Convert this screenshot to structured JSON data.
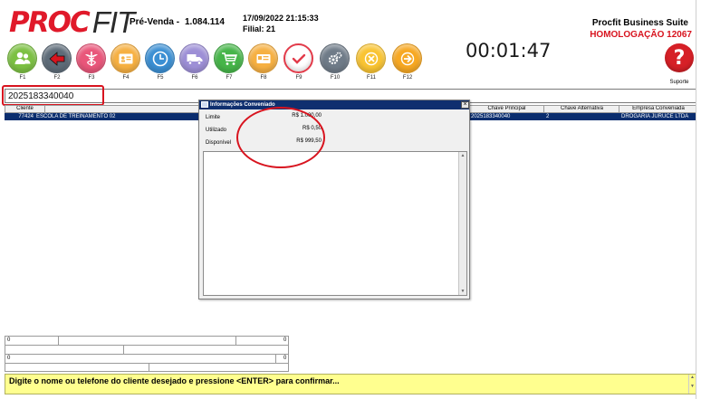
{
  "header": {
    "logo_proc": "PROC",
    "logo_fit": "FIT",
    "mode": "Pré-Venda -",
    "version": "1.084.114",
    "datetime": "17/09/2022 21:15:33",
    "filial": "Filial: 21",
    "suite": "Procfit Business Suite",
    "environment": "HOMOLOGAÇÃO 12067",
    "timer": "00:01:47"
  },
  "toolbar": {
    "keys": [
      {
        "label": "F1",
        "icon": "users-icon",
        "color": "#7cc043"
      },
      {
        "label": "F2",
        "icon": "back-arrow-icon",
        "color": "#5d6b78"
      },
      {
        "label": "F3",
        "icon": "caduceus-icon",
        "color": "#e9567a"
      },
      {
        "label": "F4",
        "icon": "id-card-icon",
        "color": "#f6b042"
      },
      {
        "label": "F5",
        "icon": "clock-icon",
        "color": "#3b8fd3"
      },
      {
        "label": "F6",
        "icon": "truck-icon",
        "color": "#9d8fd6"
      },
      {
        "label": "F7",
        "icon": "cart-icon",
        "color": "#46b549"
      },
      {
        "label": "F8",
        "icon": "card-icon",
        "color": "#f6b042"
      },
      {
        "label": "F9",
        "icon": "check-icon",
        "color": "#ffffff"
      },
      {
        "label": "F10",
        "icon": "gears-icon",
        "color": "#6f7b88"
      },
      {
        "label": "F11",
        "icon": "cancel-icon",
        "color": "#f9c433"
      },
      {
        "label": "F12",
        "icon": "next-arrow-icon",
        "color": "#f7a823"
      }
    ],
    "help_label": "Suporte",
    "help_glyph": "?"
  },
  "search": {
    "value": "2025183340040"
  },
  "grid": {
    "columns": [
      "Cliente",
      "Chave Principal",
      "Chave Alternativa",
      "Empresa Conveniada"
    ],
    "row": {
      "code": "77424",
      "name": "ESCOLA DE TREINAMENTO 02",
      "chave_principal": "2025183340040",
      "chave_alternativa": "2",
      "empresa": "DROGARIA JURUCE LTDA"
    }
  },
  "dialog": {
    "title": "Informações Conveniado",
    "close": "×",
    "rows": [
      {
        "label": "Limite",
        "value": "R$ 1.000,00"
      },
      {
        "label": "Utilizado",
        "value": "R$ 0,50"
      },
      {
        "label": "Disponível",
        "value": "R$ 999,50"
      }
    ]
  },
  "mini_grid": {
    "values": [
      "0",
      "0",
      "0",
      "0"
    ]
  },
  "status": {
    "message": "Digite o nome ou telefone do cliente desejado e pressione <ENTER> para confirmar..."
  },
  "colors": {
    "brand_red": "#e0192a",
    "selection_blue": "#0a2d6e",
    "status_yellow": "#ffff8f",
    "annotation_red": "#d8141f"
  }
}
